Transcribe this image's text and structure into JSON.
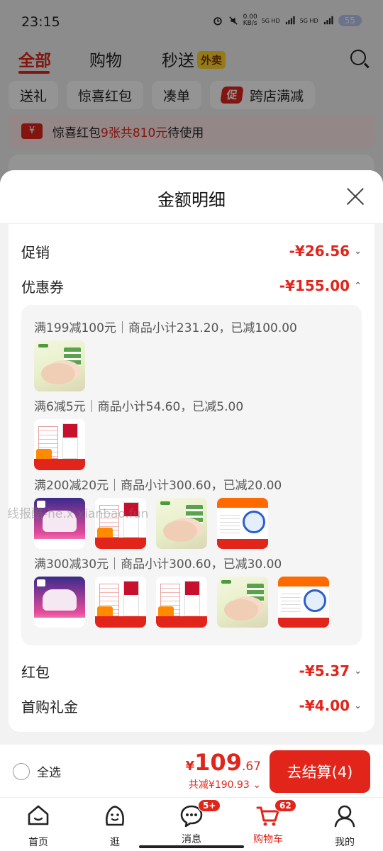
{
  "status_bar": {
    "time": "23:15",
    "net_speed": "0.00",
    "net_unit": "KB/s",
    "sig1": "5G HD",
    "sig2": "5G HD",
    "battery": "55"
  },
  "top_tabs": {
    "all": "全部",
    "shopping": "购物",
    "instant": "秒送",
    "takeout_badge": "外卖"
  },
  "chips": [
    "送礼",
    "惊喜红包",
    "凑单",
    "跨店满减"
  ],
  "chip_badge": "促",
  "hongbao_bar": {
    "icon_glyph": "¥",
    "prefix": "惊喜红包",
    "highlight": "9张共810元",
    "suffix": "待使用"
  },
  "sheet": {
    "title": "金额明细",
    "rows": [
      {
        "label": "促销",
        "amount": "-¥26.56",
        "expanded": false
      },
      {
        "label": "优惠券",
        "amount": "-¥155.00",
        "expanded": true
      },
      {
        "label": "红包",
        "amount": "-¥5.37",
        "expanded": false
      },
      {
        "label": "首购礼金",
        "amount": "-¥4.00",
        "expanded": false
      }
    ],
    "coupons": [
      {
        "text": "满199减100元｜商品小计231.20，已减100.00",
        "products": [
          "chicken"
        ]
      },
      {
        "text": "满6减5元｜商品小计54.60，已减5.00",
        "products": [
          "milk"
        ]
      },
      {
        "text": "满200减20元｜商品小计300.60，已减20.00",
        "products": [
          "diaper",
          "milk",
          "chicken",
          "promo"
        ]
      },
      {
        "text": "满300减30元｜商品小计300.60，已减30.00",
        "products": [
          "diaper",
          "milk",
          "milk",
          "chicken",
          "promo"
        ]
      }
    ]
  },
  "watermark": "线报酷-he.x.xianbao.fun",
  "checkout": {
    "select_all": "全选",
    "currency": "¥",
    "total_int": "109",
    "total_dec": ".67",
    "saved": "共减¥190.93",
    "button": "去结算(4)"
  },
  "nav": [
    {
      "label": "首页",
      "icon": "home-icon",
      "badge": ""
    },
    {
      "label": "逛",
      "icon": "explore-icon",
      "badge": ""
    },
    {
      "label": "消息",
      "icon": "message-icon",
      "badge": "5+"
    },
    {
      "label": "购物车",
      "icon": "cart-icon",
      "badge": "62"
    },
    {
      "label": "我的",
      "icon": "profile-icon",
      "badge": ""
    }
  ],
  "colors": {
    "accent": "#e1251b",
    "sheet_bg": "#f2f2f2"
  }
}
